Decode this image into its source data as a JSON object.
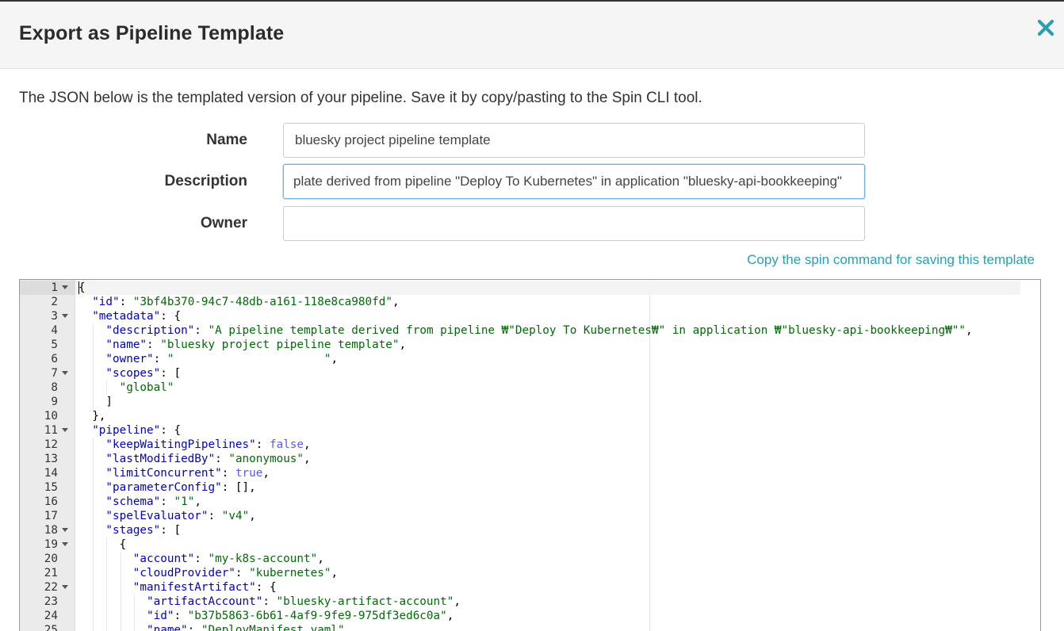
{
  "dialog": {
    "title": "Export as Pipeline Template",
    "close_icon": "close-icon",
    "intro": "The JSON below is the templated version of your pipeline. Save it by copy/pasting to the Spin CLI tool.",
    "accent_color": "#2a9fb0"
  },
  "form": {
    "name_label": "Name",
    "name_value": "bluesky project pipeline template",
    "description_label": "Description",
    "description_value": "plate derived from pipeline \"Deploy To Kubernetes\" in application \"bluesky-api-bookkeeping\"",
    "owner_label": "Owner",
    "owner_value": ""
  },
  "copy_link": "Copy the spin command for saving this template",
  "editor": {
    "lines": [
      {
        "n": "1",
        "fold": true,
        "indent": 0,
        "tokens": [
          [
            "p",
            "{"
          ]
        ]
      },
      {
        "n": "2",
        "fold": false,
        "indent": 1,
        "tokens": [
          [
            "k",
            "\"id\""
          ],
          [
            "p",
            ": "
          ],
          [
            "s",
            "\"3bf4b370-94c7-48db-a161-118e8ca980fd\""
          ],
          [
            "p",
            ","
          ]
        ]
      },
      {
        "n": "3",
        "fold": true,
        "indent": 1,
        "tokens": [
          [
            "k",
            "\"metadata\""
          ],
          [
            "p",
            ": {"
          ]
        ]
      },
      {
        "n": "4",
        "fold": false,
        "indent": 2,
        "tokens": [
          [
            "k",
            "\"description\""
          ],
          [
            "p",
            ": "
          ],
          [
            "s",
            "\"A pipeline template derived from pipeline ₩\"Deploy To Kubernetes₩\" in application ₩\"bluesky-api-bookkeeping₩\"\""
          ],
          [
            "p",
            ","
          ]
        ]
      },
      {
        "n": "5",
        "fold": false,
        "indent": 2,
        "tokens": [
          [
            "k",
            "\"name\""
          ],
          [
            "p",
            ": "
          ],
          [
            "s",
            "\"bluesky project pipeline template\""
          ],
          [
            "p",
            ","
          ]
        ]
      },
      {
        "n": "6",
        "fold": false,
        "indent": 2,
        "tokens": [
          [
            "k",
            "\"owner\""
          ],
          [
            "p",
            ": "
          ],
          [
            "s",
            "\"                      \""
          ],
          [
            "p",
            ","
          ]
        ]
      },
      {
        "n": "7",
        "fold": true,
        "indent": 2,
        "tokens": [
          [
            "k",
            "\"scopes\""
          ],
          [
            "p",
            ": ["
          ]
        ]
      },
      {
        "n": "8",
        "fold": false,
        "indent": 3,
        "tokens": [
          [
            "s",
            "\"global\""
          ]
        ]
      },
      {
        "n": "9",
        "fold": false,
        "indent": 2,
        "tokens": [
          [
            "p",
            "]"
          ]
        ]
      },
      {
        "n": "10",
        "fold": false,
        "indent": 1,
        "tokens": [
          [
            "p",
            "},"
          ]
        ]
      },
      {
        "n": "11",
        "fold": true,
        "indent": 1,
        "tokens": [
          [
            "k",
            "\"pipeline\""
          ],
          [
            "p",
            ": {"
          ]
        ]
      },
      {
        "n": "12",
        "fold": false,
        "indent": 2,
        "tokens": [
          [
            "k",
            "\"keepWaitingPipelines\""
          ],
          [
            "p",
            ": "
          ],
          [
            "b",
            "false"
          ],
          [
            "p",
            ","
          ]
        ]
      },
      {
        "n": "13",
        "fold": false,
        "indent": 2,
        "tokens": [
          [
            "k",
            "\"lastModifiedBy\""
          ],
          [
            "p",
            ": "
          ],
          [
            "s",
            "\"anonymous\""
          ],
          [
            "p",
            ","
          ]
        ]
      },
      {
        "n": "14",
        "fold": false,
        "indent": 2,
        "tokens": [
          [
            "k",
            "\"limitConcurrent\""
          ],
          [
            "p",
            ": "
          ],
          [
            "b",
            "true"
          ],
          [
            "p",
            ","
          ]
        ]
      },
      {
        "n": "15",
        "fold": false,
        "indent": 2,
        "tokens": [
          [
            "k",
            "\"parameterConfig\""
          ],
          [
            "p",
            ": [],"
          ]
        ]
      },
      {
        "n": "16",
        "fold": false,
        "indent": 2,
        "tokens": [
          [
            "k",
            "\"schema\""
          ],
          [
            "p",
            ": "
          ],
          [
            "s",
            "\"1\""
          ],
          [
            "p",
            ","
          ]
        ]
      },
      {
        "n": "17",
        "fold": false,
        "indent": 2,
        "tokens": [
          [
            "k",
            "\"spelEvaluator\""
          ],
          [
            "p",
            ": "
          ],
          [
            "s",
            "\"v4\""
          ],
          [
            "p",
            ","
          ]
        ]
      },
      {
        "n": "18",
        "fold": true,
        "indent": 2,
        "tokens": [
          [
            "k",
            "\"stages\""
          ],
          [
            "p",
            ": ["
          ]
        ]
      },
      {
        "n": "19",
        "fold": true,
        "indent": 3,
        "tokens": [
          [
            "p",
            "{"
          ]
        ]
      },
      {
        "n": "20",
        "fold": false,
        "indent": 4,
        "tokens": [
          [
            "k",
            "\"account\""
          ],
          [
            "p",
            ": "
          ],
          [
            "s",
            "\"my-k8s-account\""
          ],
          [
            "p",
            ","
          ]
        ]
      },
      {
        "n": "21",
        "fold": false,
        "indent": 4,
        "tokens": [
          [
            "k",
            "\"cloudProvider\""
          ],
          [
            "p",
            ": "
          ],
          [
            "s",
            "\"kubernetes\""
          ],
          [
            "p",
            ","
          ]
        ]
      },
      {
        "n": "22",
        "fold": true,
        "indent": 4,
        "tokens": [
          [
            "k",
            "\"manifestArtifact\""
          ],
          [
            "p",
            ": {"
          ]
        ]
      },
      {
        "n": "23",
        "fold": false,
        "indent": 5,
        "tokens": [
          [
            "k",
            "\"artifactAccount\""
          ],
          [
            "p",
            ": "
          ],
          [
            "s",
            "\"bluesky-artifact-account\""
          ],
          [
            "p",
            ","
          ]
        ]
      },
      {
        "n": "24",
        "fold": false,
        "indent": 5,
        "tokens": [
          [
            "k",
            "\"id\""
          ],
          [
            "p",
            ": "
          ],
          [
            "s",
            "\"b37b5863-6b61-4af9-9fe9-975df3ed6c0a\""
          ],
          [
            "p",
            ","
          ]
        ]
      },
      {
        "n": "25",
        "fold": false,
        "indent": 5,
        "tokens": [
          [
            "k",
            "\"name\""
          ],
          [
            "p",
            ": "
          ],
          [
            "s",
            "\"DeployManifest.yaml\""
          ],
          [
            "p",
            ","
          ]
        ]
      }
    ]
  }
}
